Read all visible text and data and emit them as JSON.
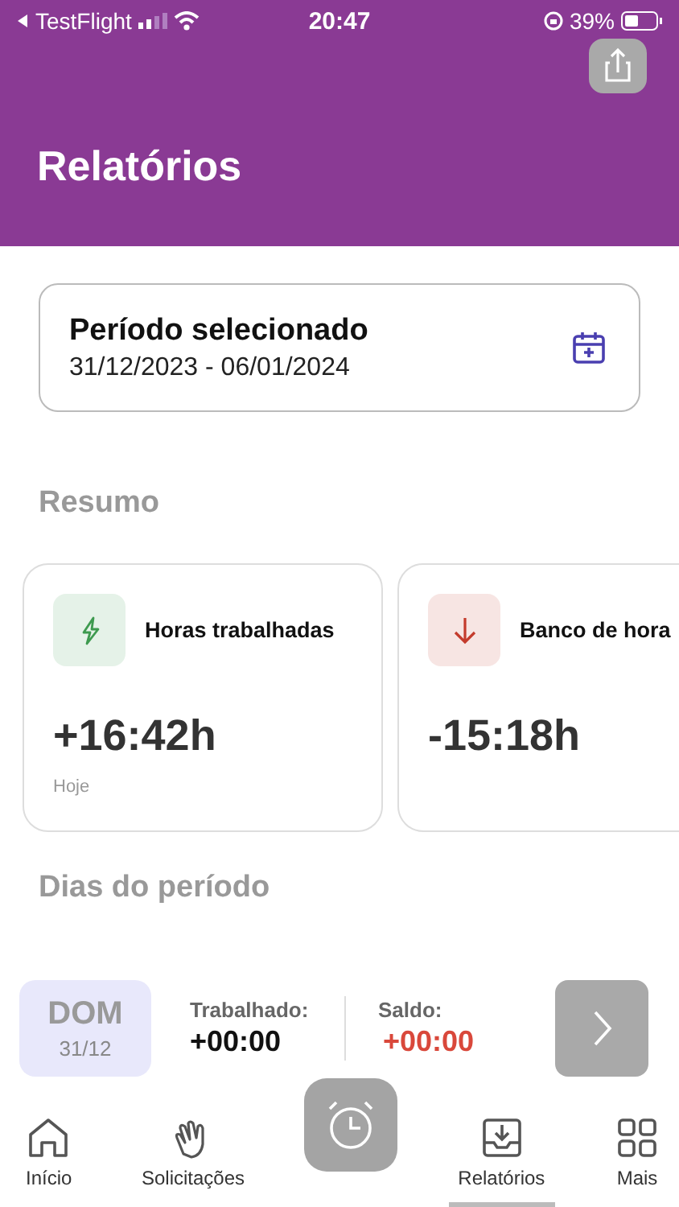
{
  "status_bar": {
    "back_app": "TestFlight",
    "time": "20:47",
    "battery": "39%"
  },
  "header": {
    "title": "Relatórios"
  },
  "period": {
    "label": "Período selecionado",
    "range": "31/12/2023 - 06/01/2024"
  },
  "summary": {
    "heading": "Resumo",
    "cards": [
      {
        "kind": "worked",
        "title": "Horas trabalhadas",
        "value": "+16:42h",
        "note": "Hoje",
        "color": "#3e9a4f"
      },
      {
        "kind": "balance",
        "title": "Banco de hora",
        "value": "-15:18h",
        "color": "#c43b2c"
      }
    ]
  },
  "days": {
    "heading": "Dias do período",
    "rows": [
      {
        "weekday": "DOM",
        "date": "31/12",
        "worked_label": "Trabalhado:",
        "worked": "+00:00",
        "balance_label": "Saldo:",
        "balance": "+00:00"
      }
    ]
  },
  "tab_bar": [
    {
      "kind": "home",
      "label": "Início",
      "selected": false
    },
    {
      "kind": "wave",
      "label": "Solicitações",
      "selected": false
    },
    {
      "kind": "clock"
    },
    {
      "kind": "report",
      "label": "Relatórios",
      "selected": true
    },
    {
      "kind": "grid",
      "label": "Mais",
      "selected": false
    }
  ]
}
